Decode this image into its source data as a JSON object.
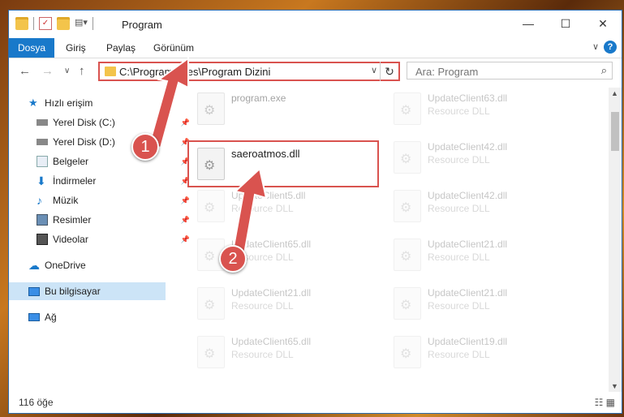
{
  "window": {
    "title": "Program",
    "controls": [
      "—",
      "☐",
      "✕"
    ]
  },
  "ribbon": {
    "tabs": [
      "Dosya",
      "Giriş",
      "Paylaş",
      "Görünüm"
    ],
    "help": "?",
    "collapse": "∨"
  },
  "nav": {
    "back": "←",
    "forward": "→",
    "recent": "∨",
    "up": "↑",
    "address": "C:\\Program Files\\Program Dizini",
    "address_dropdown": "∨",
    "refresh": "↻",
    "search_placeholder": "Ara: Program",
    "search_icon": "⌕"
  },
  "sidebar": {
    "items": [
      {
        "label": "Hızlı erişim",
        "icon": "star-icon",
        "pinned": false
      },
      {
        "label": "Yerel Disk (C:)",
        "icon": "drive-icon",
        "pinned": true
      },
      {
        "label": "Yerel Disk (D:)",
        "icon": "drive-icon",
        "pinned": true
      },
      {
        "label": "Belgeler",
        "icon": "documents-icon",
        "pinned": true
      },
      {
        "label": "İndirmeler",
        "icon": "download-icon",
        "pinned": true
      },
      {
        "label": "Müzik",
        "icon": "music-icon",
        "pinned": true
      },
      {
        "label": "Resimler",
        "icon": "pictures-icon",
        "pinned": true
      },
      {
        "label": "Videolar",
        "icon": "video-icon",
        "pinned": true
      },
      {
        "label": "OneDrive",
        "icon": "cloud-icon",
        "pinned": false
      },
      {
        "label": "Bu bilgisayar",
        "icon": "computer-icon",
        "pinned": false
      },
      {
        "label": "Ağ",
        "icon": "network-icon",
        "pinned": false
      }
    ],
    "pin_glyph": "📌"
  },
  "files": [
    {
      "name": "program.exe",
      "type": ""
    },
    {
      "name": "UpdateClient63.dll",
      "type": "Resource DLL"
    },
    {
      "name": "saeroatmos.dll",
      "type": ""
    },
    {
      "name": "UpdateClient42.dll",
      "type": "Resource DLL"
    },
    {
      "name": "UpdateClient5.dll",
      "type": "Resource DLL"
    },
    {
      "name": "UpdateClient42.dll",
      "type": "Resource DLL"
    },
    {
      "name": "UpdateClient65.dll",
      "type": "Resource DLL"
    },
    {
      "name": "UpdateClient21.dll",
      "type": "Resource DLL"
    },
    {
      "name": "UpdateClient21.dll",
      "type": "Resource DLL"
    },
    {
      "name": "UpdateClient21.dll",
      "type": "Resource DLL"
    },
    {
      "name": "UpdateClient65.dll",
      "type": "Resource DLL"
    },
    {
      "name": "UpdateClient19.dll",
      "type": "Resource DLL"
    }
  ],
  "status": {
    "count": "116 öğe",
    "view_icons": "☷ ▦"
  },
  "annotations": {
    "badge1": "1",
    "badge2": "2"
  },
  "colors": {
    "accent": "#1979ca",
    "highlight": "#d9534f",
    "selected": "#cce4f7"
  }
}
